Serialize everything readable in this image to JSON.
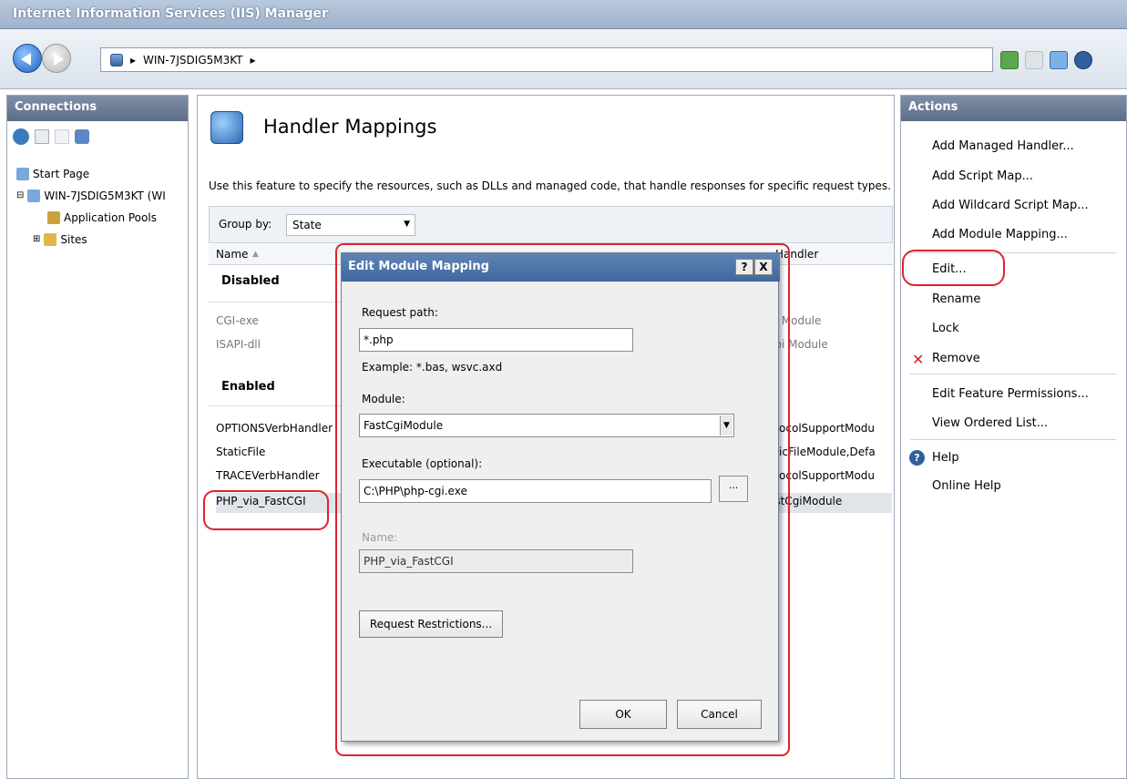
{
  "window": {
    "title": "Internet Information Services (IIS) Manager"
  },
  "address": {
    "path": "WIN-7JSDIG5M3KT",
    "separator": "▸"
  },
  "connections": {
    "title": "Connections",
    "tree": [
      {
        "label": "Start Page"
      },
      {
        "label": "WIN-7JSDIG5M3KT (WI"
      },
      {
        "label": "Application Pools"
      },
      {
        "label": "Sites"
      }
    ]
  },
  "feature": {
    "title": "Handler Mappings",
    "description": "Use this feature to specify the resources, such as DLLs and managed code, that handle responses for specific request types.",
    "group_by_label": "Group by:",
    "group_by_value": "State",
    "columns": {
      "name": "Name",
      "handler": "Handler"
    },
    "groups": [
      {
        "label": "Disabled",
        "rows": [
          {
            "name": "CGI-exe",
            "handler": "gi Module"
          },
          {
            "name": "ISAPI-dll",
            "handler": "api Module"
          }
        ]
      },
      {
        "label": "Enabled",
        "rows": [
          {
            "name": "OPTIONSVerbHandler",
            "handler": "otocolSupportModu"
          },
          {
            "name": "StaticFile",
            "handler": "aticFileModule,Defa"
          },
          {
            "name": "TRACEVerbHandler",
            "handler": "otocolSupportModu"
          },
          {
            "name": "PHP_via_FastCGI",
            "handler": "astCgiModule"
          }
        ]
      }
    ]
  },
  "actions": {
    "title": "Actions",
    "items": [
      "Add Managed Handler...",
      "Add Script Map...",
      "Add Wildcard Script Map...",
      "Add Module Mapping...",
      "Edit...",
      "Rename",
      "Lock",
      "Remove",
      "Edit Feature Permissions...",
      "View Ordered List...",
      "Help",
      "Online Help"
    ]
  },
  "dialog": {
    "title": "Edit Module Mapping",
    "help_btn": "?",
    "close_btn": "X",
    "request_path_label": "Request path:",
    "request_path_value": "*.php",
    "example_text": "Example: *.bas, wsvc.axd",
    "module_label": "Module:",
    "module_value": "FastCgiModule",
    "executable_label": "Executable (optional):",
    "executable_value": "C:\\PHP\\php-cgi.exe",
    "browse_label": "...",
    "name_label": "Name:",
    "name_value": "PHP_via_FastCGI",
    "restrictions_btn": "Request Restrictions...",
    "ok_btn": "OK",
    "cancel_btn": "Cancel"
  },
  "colors": {
    "highlight": "#e0232c",
    "title_blue": "#3f689e"
  }
}
